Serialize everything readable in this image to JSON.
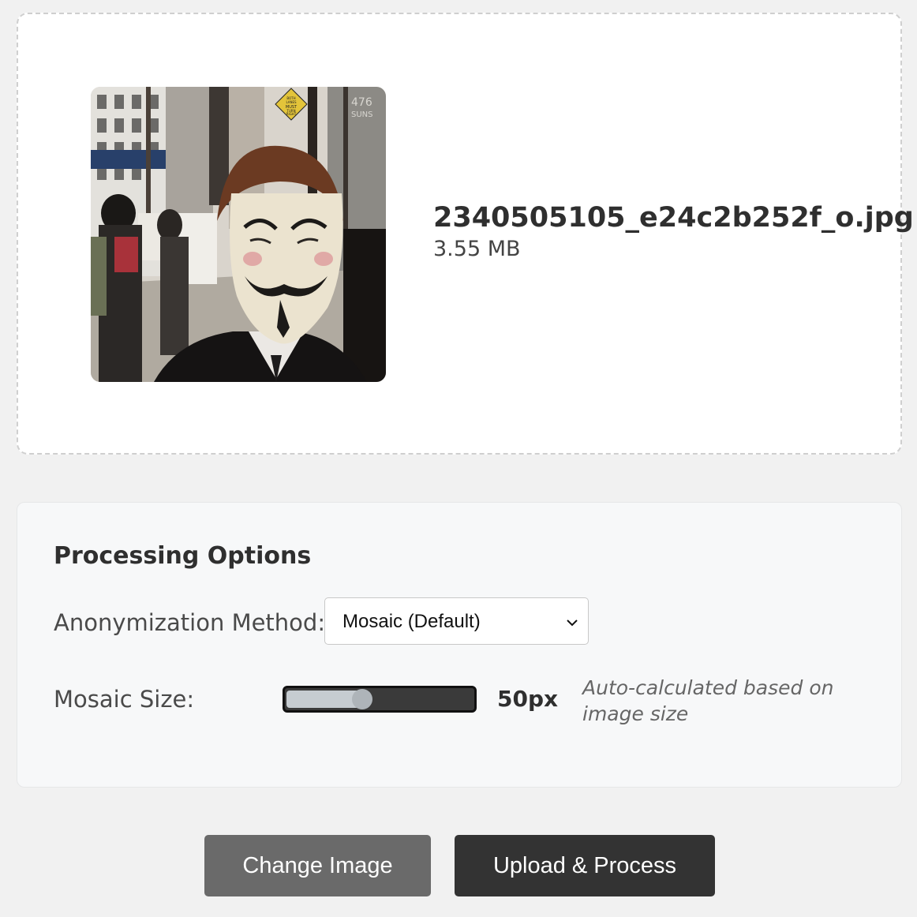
{
  "file": {
    "name": "2340505105_e24c2b252f_o.jpg",
    "size": "3.55 MB",
    "sign_text": [
      "BOTH",
      "LANES",
      "MUST",
      "TURN",
      "RIGHT"
    ],
    "building_number": "476",
    "building_text": "SUNS"
  },
  "options": {
    "title": "Processing Options",
    "method_label": "Anonymization Method:",
    "method_selected": "Mosaic (Default)",
    "size_label": "Mosaic Size:",
    "size_value": "50px",
    "size_fraction": 0.41,
    "size_hint": "Auto-calculated based on image size"
  },
  "actions": {
    "change_label": "Change Image",
    "upload_label": "Upload & Process"
  },
  "colors": {
    "primary_button": "#333333",
    "secondary_button": "#6a6a6a",
    "slider_track": "#3a3a3a",
    "slider_fill": "#c6ccd1"
  }
}
